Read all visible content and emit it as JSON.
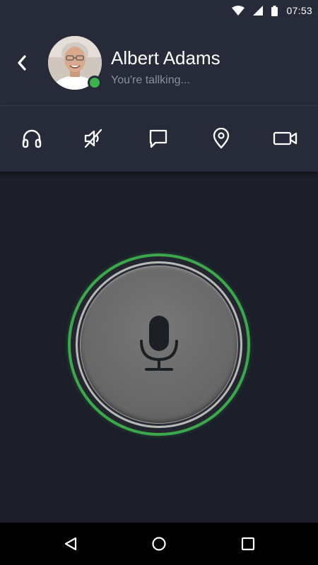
{
  "status_bar": {
    "time": "07:53",
    "icons": [
      "wifi-icon",
      "signal-icon",
      "battery-icon"
    ]
  },
  "header": {
    "contact_name": "Albert Adams",
    "contact_status": "You're tallking...",
    "presence": "online",
    "presence_color": "#3cb34a",
    "icons": [
      "back-arrow-icon"
    ]
  },
  "toolbar": {
    "items": [
      {
        "icon": "headphones-icon"
      },
      {
        "icon": "speaker-muted-icon"
      },
      {
        "icon": "chat-bubble-icon"
      },
      {
        "icon": "location-pin-icon"
      },
      {
        "icon": "video-camera-icon"
      }
    ]
  },
  "push_to_talk": {
    "icon": "microphone-icon",
    "active_ring_color": "#3aa84b"
  },
  "nav_bar": {
    "icons": [
      "nav-back-icon",
      "nav-home-icon",
      "nav-recents-icon"
    ]
  },
  "colors": {
    "background": "#1c1f2a",
    "header": "#272b39",
    "accent_green": "#3aa84b"
  }
}
